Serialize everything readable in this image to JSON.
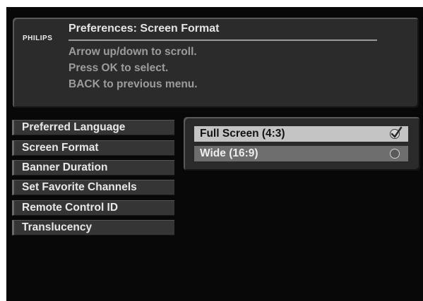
{
  "header": {
    "brand": "PHILIPS",
    "title": "Preferences: Screen Format",
    "instructions": [
      "Arrow up/down to scroll.",
      "Press OK to select.",
      "BACK to previous menu."
    ]
  },
  "menu": {
    "items": [
      {
        "label": "Preferred Language"
      },
      {
        "label": "Screen Format"
      },
      {
        "label": "Banner Duration"
      },
      {
        "label": "Set Favorite Channels"
      },
      {
        "label": "Remote Control ID"
      },
      {
        "label": "Translucency"
      }
    ]
  },
  "options": [
    {
      "label": "Full Screen (4:3)",
      "selected": true,
      "icon": "checkmark-icon"
    },
    {
      "label": "Wide (16:9)",
      "selected": false,
      "icon": "radio-empty-icon"
    }
  ],
  "colors": {
    "background": "#080808",
    "panel": "#2b2b2b",
    "selected_row": "#c4c4c4",
    "unselected_row": "#6e6e6e"
  }
}
